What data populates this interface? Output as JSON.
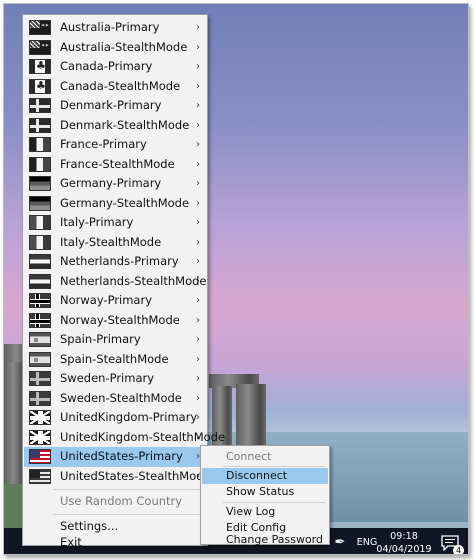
{
  "menu": {
    "countries": [
      {
        "label": "Australia-Primary",
        "flag": "australia-flag-icon",
        "flag_class": "f-au"
      },
      {
        "label": "Australia-StealthMode",
        "flag": "australia-flag-icon",
        "flag_class": "f-au"
      },
      {
        "label": "Canada-Primary",
        "flag": "canada-flag-icon",
        "flag_class": "f-ca"
      },
      {
        "label": "Canada-StealthMode",
        "flag": "canada-flag-icon",
        "flag_class": "f-ca"
      },
      {
        "label": "Denmark-Primary",
        "flag": "denmark-flag-icon",
        "flag_class": "f-dk"
      },
      {
        "label": "Denmark-StealthMode",
        "flag": "denmark-flag-icon",
        "flag_class": "f-dk"
      },
      {
        "label": "France-Primary",
        "flag": "france-flag-icon",
        "flag_class": "f-fr"
      },
      {
        "label": "France-StealthMode",
        "flag": "france-flag-icon",
        "flag_class": "f-fr"
      },
      {
        "label": "Germany-Primary",
        "flag": "germany-flag-icon",
        "flag_class": "f-de"
      },
      {
        "label": "Germany-StealthMode",
        "flag": "germany-flag-icon",
        "flag_class": "f-de"
      },
      {
        "label": "Italy-Primary",
        "flag": "italy-flag-icon",
        "flag_class": "f-it"
      },
      {
        "label": "Italy-StealthMode",
        "flag": "italy-flag-icon",
        "flag_class": "f-it"
      },
      {
        "label": "Netherlands-Primary",
        "flag": "netherlands-flag-icon",
        "flag_class": "f-nl"
      },
      {
        "label": "Netherlands-StealthMode",
        "flag": "netherlands-flag-icon",
        "flag_class": "f-nl"
      },
      {
        "label": "Norway-Primary",
        "flag": "norway-flag-icon",
        "flag_class": "f-no"
      },
      {
        "label": "Norway-StealthMode",
        "flag": "norway-flag-icon",
        "flag_class": "f-no"
      },
      {
        "label": "Spain-Primary",
        "flag": "spain-flag-icon",
        "flag_class": "f-es"
      },
      {
        "label": "Spain-StealthMode",
        "flag": "spain-flag-icon",
        "flag_class": "f-es"
      },
      {
        "label": "Sweden-Primary",
        "flag": "sweden-flag-icon",
        "flag_class": "f-se"
      },
      {
        "label": "Sweden-StealthMode",
        "flag": "sweden-flag-icon",
        "flag_class": "f-se"
      },
      {
        "label": "UnitedKingdom-Primary",
        "flag": "uk-flag-icon",
        "flag_class": "f-uk"
      },
      {
        "label": "UnitedKingdom-StealthMode",
        "flag": "uk-flag-icon",
        "flag_class": "f-uk"
      },
      {
        "label": "UnitedStates-Primary",
        "flag": "us-flag-icon",
        "flag_class": "f-us",
        "selected": true
      },
      {
        "label": "UnitedStates-StealthMode",
        "flag": "us-flag-icon",
        "flag_class": "f-usg"
      }
    ],
    "submenu_chevron": "›",
    "use_random_country": "Use Random Country",
    "settings": "Settings...",
    "exit": "Exit",
    "highlight_color": "#99c9ef"
  },
  "submenu": {
    "connect": "Connect",
    "disconnect": "Disconnect",
    "show_status": "Show Status",
    "view_log": "View Log",
    "edit_config": "Edit Config",
    "change_password": "Change Password"
  },
  "taskbar": {
    "language": "ENG",
    "time": "09:18",
    "date": "04/04/2019",
    "notification_count": "4"
  }
}
